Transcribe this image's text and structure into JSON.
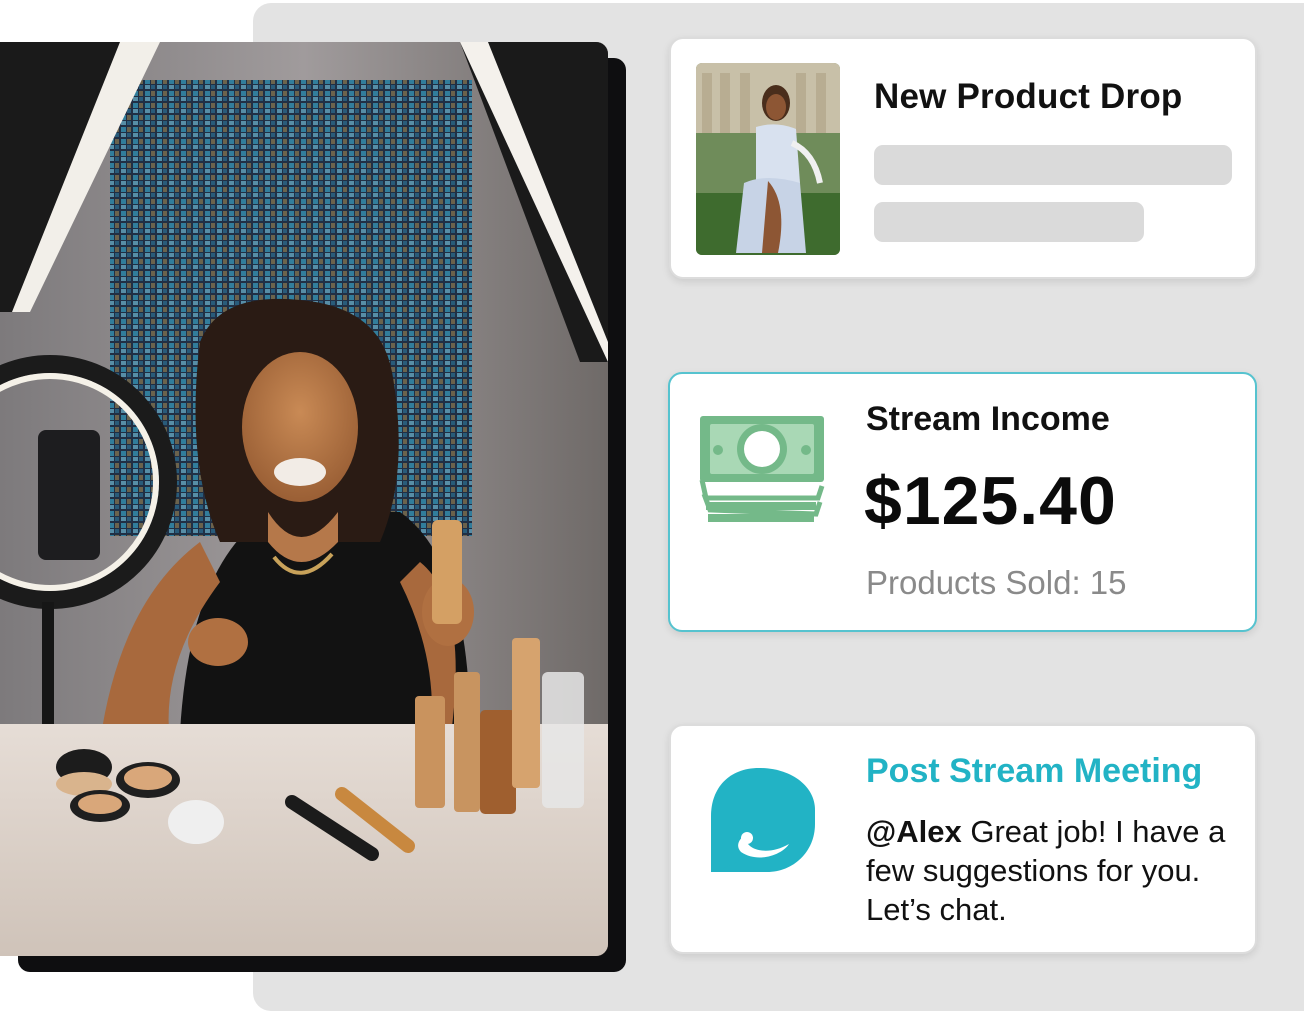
{
  "product_card": {
    "title": "New Product Drop",
    "thumbnail_icon": "model-photo-thumbnail"
  },
  "income_card": {
    "title": "Stream Income",
    "amount": "$125.40",
    "products_sold": "Products Sold: 15",
    "icon": "cash-stack-icon",
    "icon_color": "#74b989"
  },
  "meeting_card": {
    "title": "Post Stream Meeting",
    "mention": "@Alex",
    "message": " Great job! I have a few suggestions for you. Let’s chat.",
    "icon": "chat-bubble-icon",
    "accent": "#22b3c5"
  },
  "colors": {
    "backdrop": "#e3e3e3",
    "income_border": "#56c3cf",
    "skeleton": "#dadada"
  }
}
